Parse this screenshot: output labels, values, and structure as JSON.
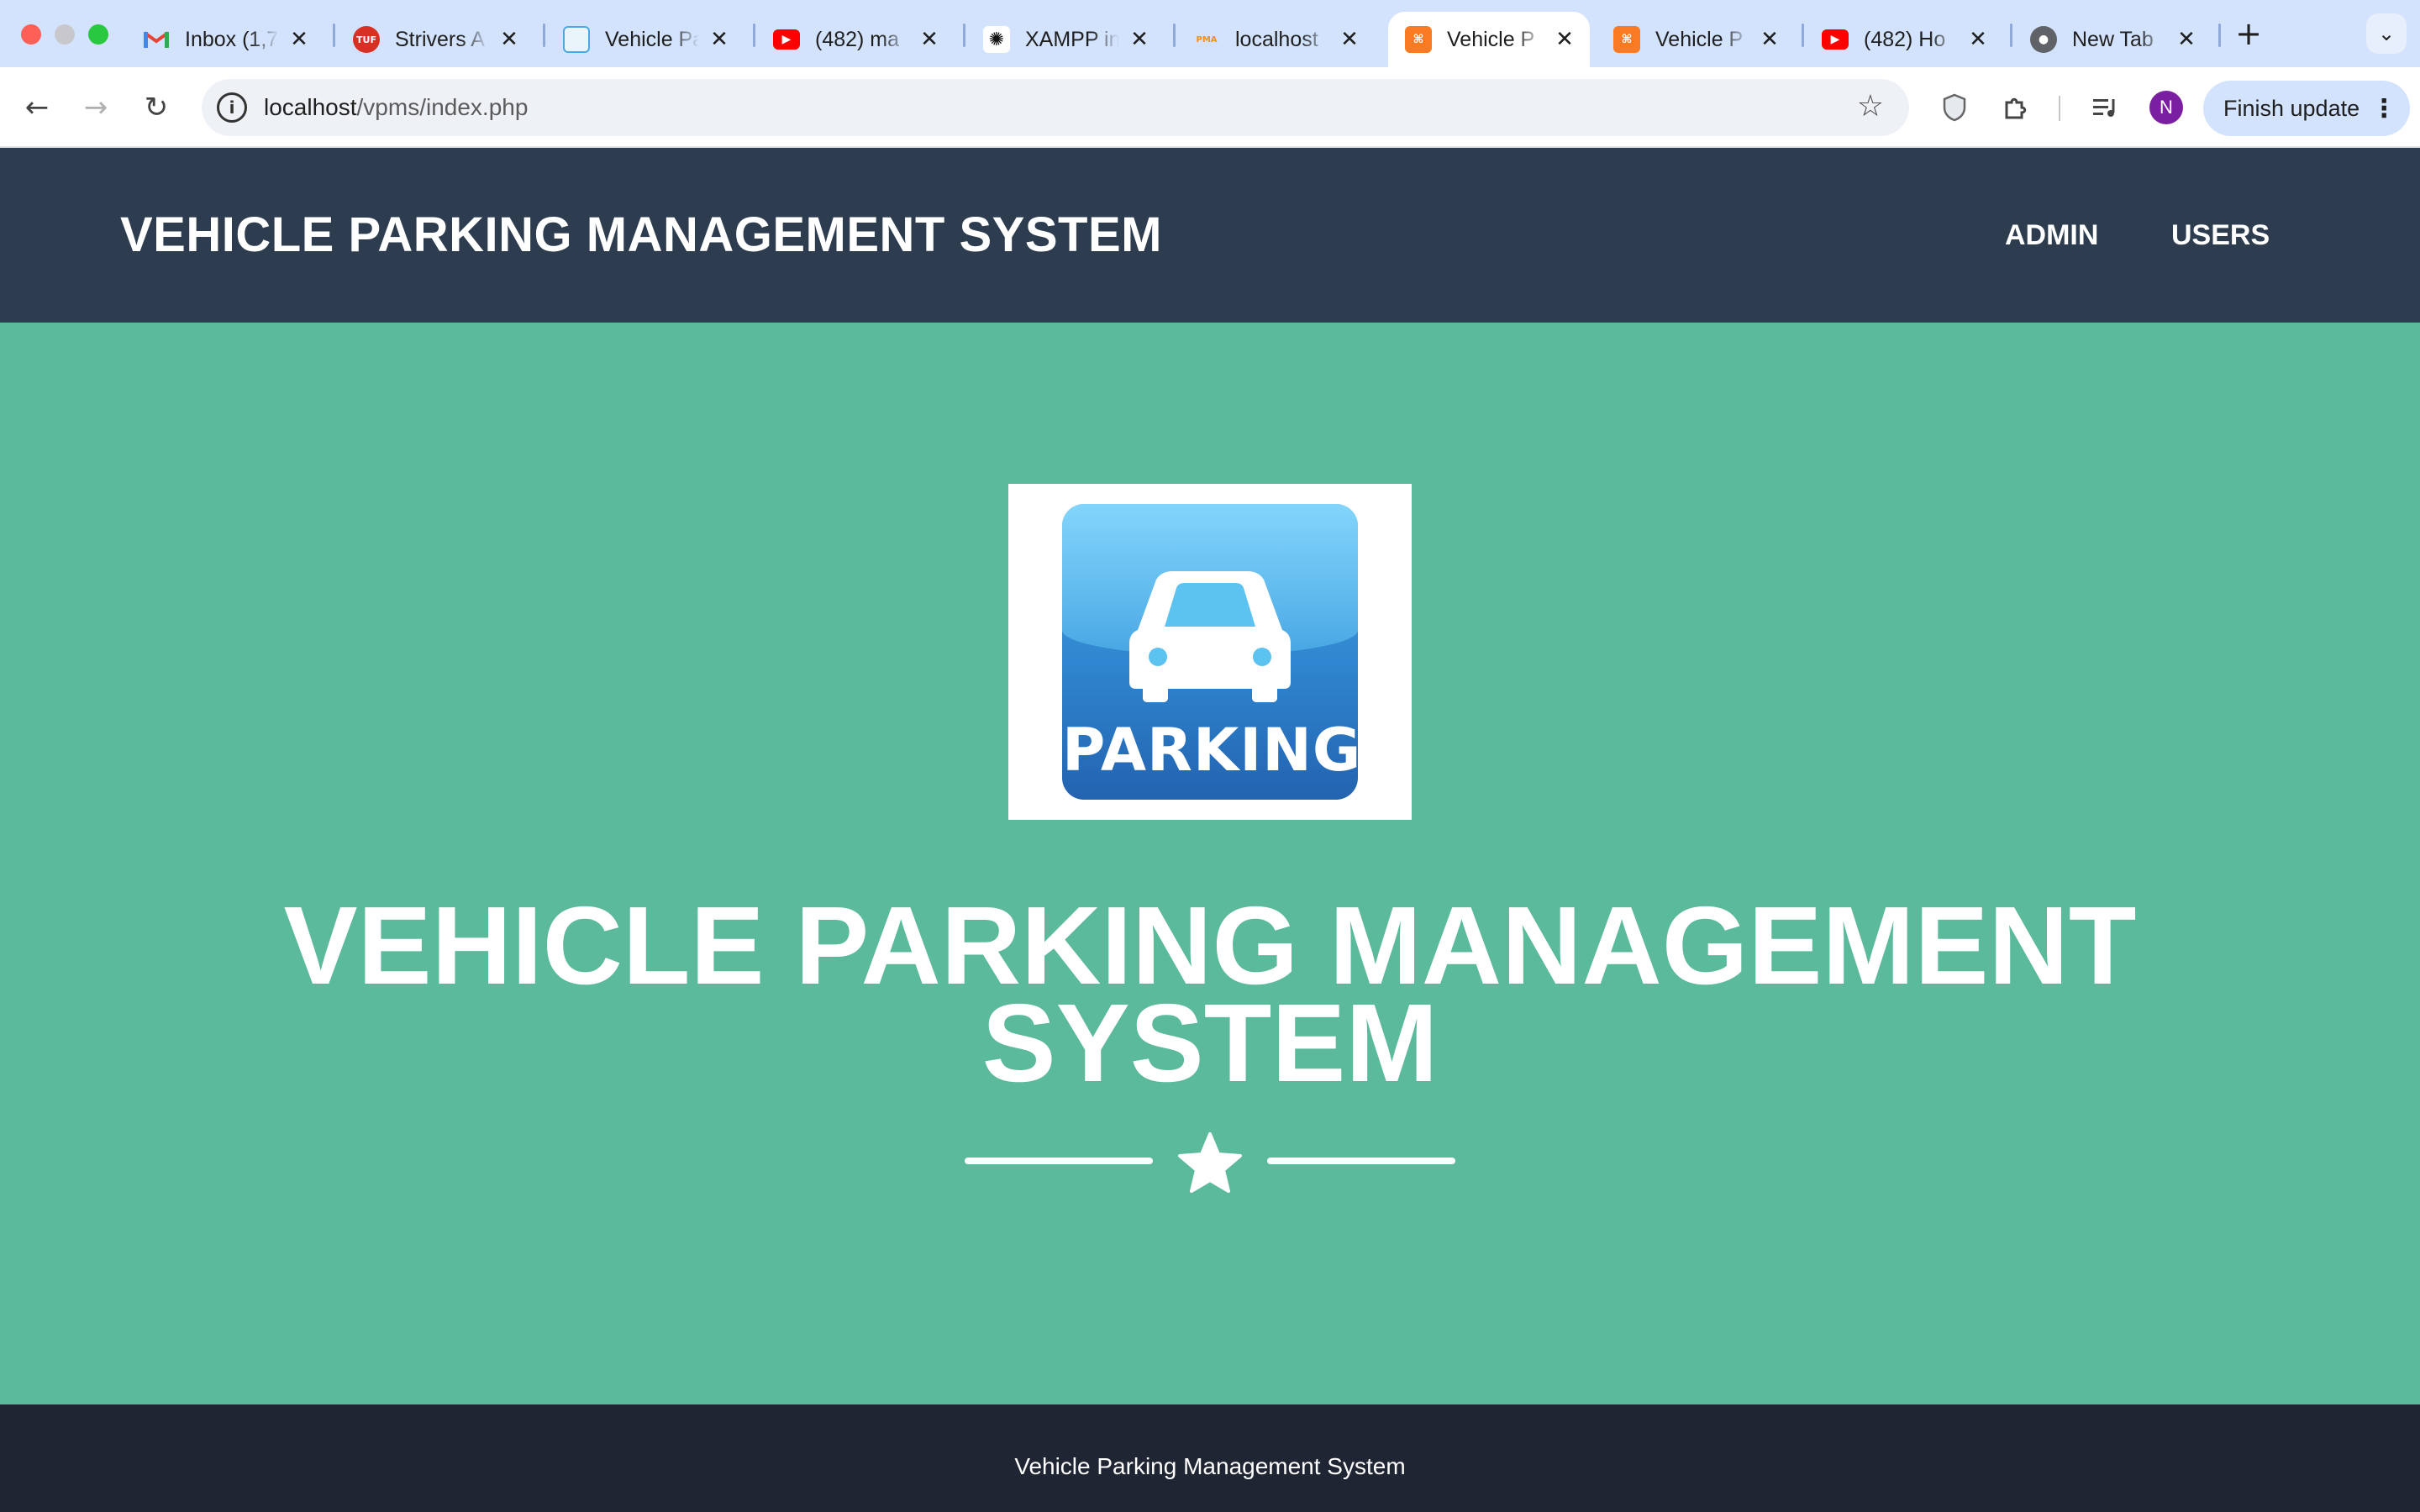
{
  "browser": {
    "tabs": [
      {
        "title": "Inbox (1,7",
        "icon": "gmail-icon",
        "color": "#ea4335"
      },
      {
        "title": "Strivers A",
        "icon": "tuf-icon",
        "color": "#d93025"
      },
      {
        "title": "Vehicle Pa",
        "icon": "site-icon",
        "color": "#4aa8e6"
      },
      {
        "title": "(482) ma",
        "icon": "youtube-icon",
        "color": "#ff0000"
      },
      {
        "title": "XAMPP in",
        "icon": "openai-icon",
        "color": "#111111"
      },
      {
        "title": "localhost",
        "icon": "phpmyadmin-icon",
        "color": "#f29111"
      },
      {
        "title": "Vehicle P",
        "icon": "xampp-icon",
        "color": "#fb7a24",
        "active": true
      },
      {
        "title": "Vehicle P",
        "icon": "xampp-icon",
        "color": "#fb7a24"
      },
      {
        "title": "(482) Ho",
        "icon": "youtube-icon",
        "color": "#ff0000"
      },
      {
        "title": "New Tab",
        "icon": "chrome-icon",
        "color": "#5f6368"
      }
    ],
    "url_host": "localhost",
    "url_path": "/vpms/index.php",
    "avatar_initial": "N",
    "finish_update_label": "Finish update"
  },
  "site": {
    "brand": "VEHICLE PARKING MANAGEMENT SYSTEM",
    "nav": [
      "ADMIN",
      "USERS"
    ],
    "logo_text": "PARKING",
    "hero_title_line1": "VEHICLE PARKING MANAGEMENT",
    "hero_title_line2": "SYSTEM",
    "footer": "Vehicle Parking Management System"
  },
  "colors": {
    "nav_bg": "#2d3c4f",
    "hero_bg": "#5bb99c",
    "footer_bg": "#1f2532",
    "logo_blue": "#2f85cf"
  }
}
